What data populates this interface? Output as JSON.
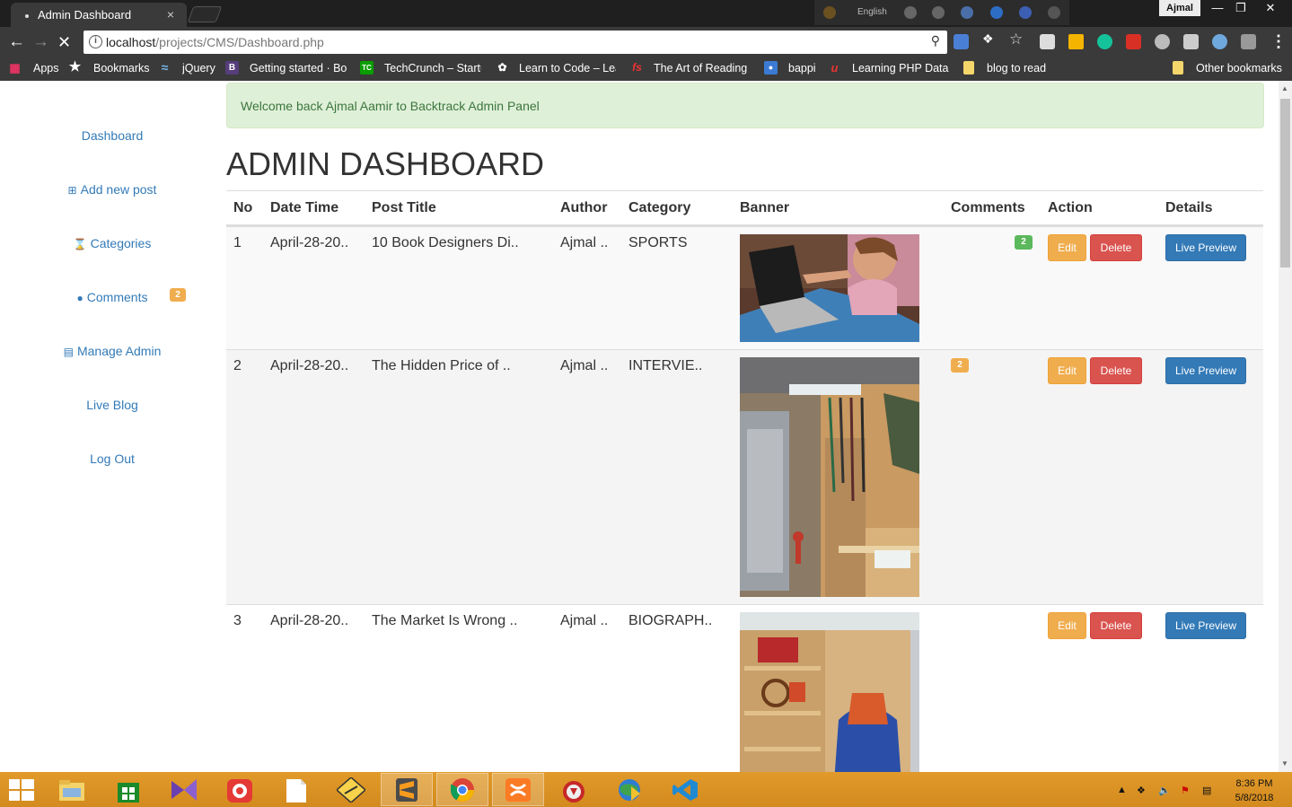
{
  "browser": {
    "tab_title": "Admin Dashboard",
    "tab_close": "×",
    "lang_label": "English",
    "user_chip": "Ajmal",
    "url_host": "localhost",
    "url_path": "/projects/CMS/Dashboard.php",
    "bookmarks": [
      {
        "label": "Apps"
      },
      {
        "label": "Bookmarks"
      },
      {
        "label": "jQuery"
      },
      {
        "label": "Getting started · Boo"
      },
      {
        "label": "TechCrunch – Startu"
      },
      {
        "label": "Learn to Code – Lea"
      },
      {
        "label": "The Art of Reading -"
      },
      {
        "label": "bappi"
      },
      {
        "label": "Learning PHP Data C"
      },
      {
        "label": "blog to read"
      },
      {
        "label": "Other bookmarks"
      }
    ]
  },
  "sidebar": {
    "items": [
      {
        "label": "Dashboard"
      },
      {
        "label": "Add new post"
      },
      {
        "label": "Categories"
      },
      {
        "label": "Comments"
      },
      {
        "label": "Manage Admin"
      },
      {
        "label": "Live Blog"
      },
      {
        "label": "Log Out"
      }
    ],
    "comments_badge": "2"
  },
  "alert": {
    "text": "Welcome back Ajmal Aamir to Backtrack Admin Panel"
  },
  "page_title": "ADMIN DASHBOARD",
  "table": {
    "headers": [
      "No",
      "Date Time",
      "Post Title",
      "Author",
      "Category",
      "Banner",
      "Comments",
      "Action",
      "Details"
    ],
    "rows": [
      {
        "no": "1",
        "date": "April-28-20..",
        "title": "10 Book Designers Di..",
        "author": "Ajmal ..",
        "category": "SPORTS",
        "approved": "2",
        "pending": "",
        "edit": "Edit",
        "delete": "Delete",
        "preview": "Live Preview"
      },
      {
        "no": "2",
        "date": "April-28-20..",
        "title": "The Hidden Price of ..",
        "author": "Ajmal ..",
        "category": "INTERVIE..",
        "approved": "",
        "pending": "2",
        "edit": "Edit",
        "delete": "Delete",
        "preview": "Live Preview"
      },
      {
        "no": "3",
        "date": "April-28-20..",
        "title": "The Market Is Wrong ..",
        "author": "Ajmal ..",
        "category": "BIOGRAPH..",
        "approved": "",
        "pending": "",
        "edit": "Edit",
        "delete": "Delete",
        "preview": "Live Preview"
      }
    ]
  },
  "colors": {
    "link": "#337ab7",
    "success": "#5cb85c",
    "warning": "#f0ad4e",
    "danger": "#d9534f",
    "primary": "#337ab7",
    "taskbar": "#d38a1e"
  },
  "taskbar": {
    "time": "8:36 PM",
    "date": "5/8/2018"
  }
}
